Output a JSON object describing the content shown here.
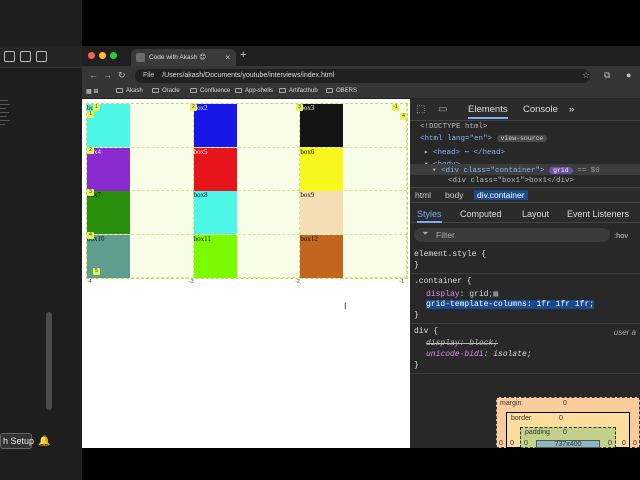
{
  "left_panel": {
    "setup_label": "h Setup"
  },
  "browser": {
    "tab_title": "Code with Akash 😊",
    "tab_close": "×",
    "new_tab": "+",
    "url_scheme": "File",
    "url": "/Users/akash/Documents/youtube/interviews/index.html",
    "bookmarks": [
      "Akash",
      "Oracle",
      "Confluence",
      "App-shells",
      "Artifacthub",
      "OBERS"
    ]
  },
  "page": {
    "boxes": [
      {
        "label": "box1",
        "color": "#4df7e8"
      },
      {
        "label": "box2",
        "color": "#1717e8"
      },
      {
        "label": "box3",
        "color": "#141414"
      },
      {
        "label": "box4",
        "color": "#8a2bd0"
      },
      {
        "label": "box5",
        "color": "#e8141b"
      },
      {
        "label": "box6",
        "color": "#f7f71b"
      },
      {
        "label": "box7",
        "color": "#2b8f0e"
      },
      {
        "label": "box8",
        "color": "#4df7e8"
      },
      {
        "label": "box9",
        "color": "#f5deb3"
      },
      {
        "label": "box10",
        "color": "#5f9e8f"
      },
      {
        "label": "box11",
        "color": "#7cfc00"
      },
      {
        "label": "box12",
        "color": "#c4651f"
      }
    ],
    "line_numbers_top": [
      "1",
      "2",
      "3",
      "4"
    ],
    "line_numbers_bottom": [
      "-4",
      "-3",
      "-2",
      "-1"
    ],
    "line_numbers_left": [
      "1",
      "2",
      "3",
      "4",
      "5"
    ],
    "right_line_numbers": [
      "-1",
      "4"
    ]
  },
  "devtools": {
    "tabs": {
      "elements": "Elements",
      "console": "Console",
      "more": "»"
    },
    "dom": {
      "doctype": "<!DOCTYPE html>",
      "html_open": "<html lang=\"en\">",
      "view_source": "view-source",
      "head": "<head> ⋯ </head>",
      "body": "<body>",
      "container": "<div class=\"container\">",
      "grid_badge": "grid",
      "eq": "== $0",
      "next": "<div class=\"box1\">box1</div>"
    },
    "breadcrumbs": [
      "html",
      "body",
      "div.container"
    ],
    "subtabs": [
      "Styles",
      "Computed",
      "Layout",
      "Event Listeners"
    ],
    "filter_placeholder": "Filter",
    "hov": ":hov",
    "rules": {
      "element_style": "element.style {",
      "close": "}",
      "container_selector": ".container {",
      "display_prop": "display",
      "display_val": "grid",
      "gtc_prop": "grid-template-columns",
      "gtc_val": "1fr 1fr 1fr",
      "div_selector": "div {",
      "ua_label": "user a",
      "div_display_prop": "display",
      "div_display_val": "block",
      "unicode_prop": "unicode-bidi",
      "unicode_val": "isolate"
    },
    "boxmodel": {
      "margin_label": "margin",
      "margin_val": "0",
      "border_label": "border",
      "border_val": "0",
      "padding_label": "padding",
      "padding_val": "0",
      "content": "737x400",
      "side_val": "0"
    }
  }
}
